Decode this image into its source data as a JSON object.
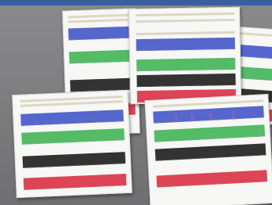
{
  "scene": {
    "description_free": true,
    "colors": {
      "background": "#7e7e80",
      "top_bar": "#3a5fa0",
      "paper": "#f7f7f5",
      "trace_blue": "#5566cc",
      "trace_green": "#55bb66",
      "trace_black": "#333333",
      "trace_red": "#dd4455",
      "trace_purple": "#8866bb"
    },
    "documents": [
      {
        "id": "doc-1",
        "traces": [
          "blue",
          "green",
          "black",
          "red"
        ]
      },
      {
        "id": "doc-2",
        "traces": [
          "black",
          "blue",
          "green",
          "red"
        ]
      },
      {
        "id": "doc-3",
        "traces": [
          "blue",
          "green",
          "black"
        ]
      },
      {
        "id": "doc-4",
        "traces": [
          "blue",
          "green",
          "black",
          "red"
        ]
      },
      {
        "id": "doc-5",
        "traces": [
          "blue",
          "green",
          "black",
          "red"
        ]
      }
    ]
  }
}
